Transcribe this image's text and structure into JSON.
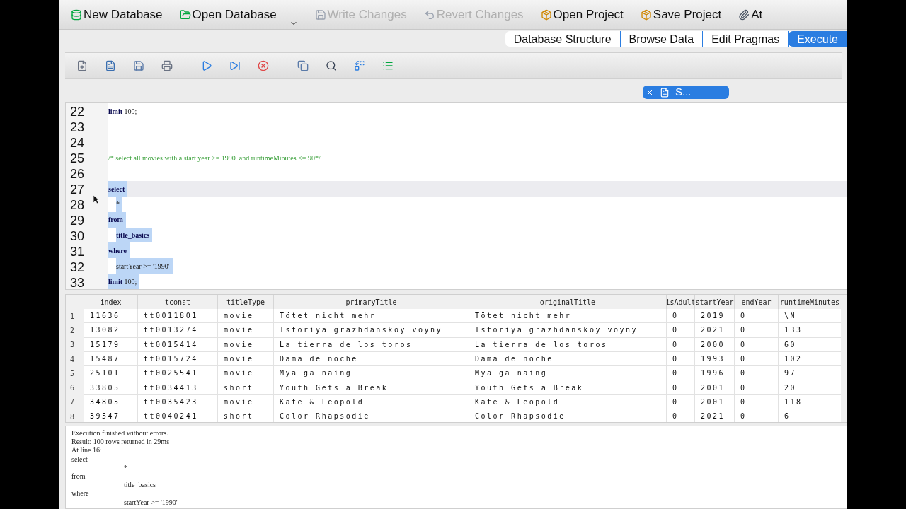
{
  "toolbar": [
    {
      "label": "New Database",
      "disabled": false,
      "dropdown": false
    },
    {
      "label": "Open Database",
      "disabled": false,
      "dropdown": true
    },
    {
      "label": "Write Changes",
      "disabled": true,
      "dropdown": false
    },
    {
      "label": "Revert Changes",
      "disabled": true,
      "dropdown": false
    },
    {
      "label": "Open Project",
      "disabled": false,
      "dropdown": false
    },
    {
      "label": "Save Project",
      "disabled": false,
      "dropdown": false
    },
    {
      "label": "At",
      "disabled": false,
      "dropdown": false
    }
  ],
  "tabs": [
    {
      "label": "Database Structure",
      "selected": false
    },
    {
      "label": "Browse Data",
      "selected": false
    },
    {
      "label": "Edit Pragmas",
      "selected": false
    },
    {
      "label": "Execute",
      "selected": true
    }
  ],
  "sql_tab": {
    "label": "S..."
  },
  "editor": {
    "lines": [
      {
        "number": "22",
        "indent": false,
        "selected": false,
        "current": false,
        "tokens": [
          {
            "text": "limit",
            "kind": "keyword"
          },
          {
            "text": " 100;",
            "kind": "plain"
          }
        ]
      },
      {
        "number": "23",
        "selected": false,
        "current": false
      },
      {
        "number": "24",
        "selected": false,
        "current": false
      },
      {
        "number": "25",
        "indent": false,
        "selected": false,
        "current": false,
        "tokens": [
          {
            "text": "/* select all movies with a start year >= 1990  and runtimeMinutes <= 90*/",
            "kind": "comment"
          }
        ]
      },
      {
        "number": "26",
        "selected": false,
        "current": false
      },
      {
        "number": "27",
        "indent": false,
        "selected": true,
        "current": true,
        "tokens": [
          {
            "text": "select",
            "kind": "keyword"
          }
        ]
      },
      {
        "number": "28",
        "indent": true,
        "selected": true,
        "current": false,
        "tokens": [
          {
            "text": "*",
            "kind": "plain"
          }
        ]
      },
      {
        "number": "29",
        "indent": false,
        "selected": true,
        "current": false,
        "tokens": [
          {
            "text": "from",
            "kind": "keyword"
          }
        ]
      },
      {
        "number": "30",
        "indent": true,
        "selected": true,
        "current": false,
        "tokens": [
          {
            "text": "title_basics",
            "kind": "keyword"
          }
        ]
      },
      {
        "number": "31",
        "indent": false,
        "selected": true,
        "current": false,
        "tokens": [
          {
            "text": "where",
            "kind": "keyword"
          }
        ]
      },
      {
        "number": "32",
        "indent": true,
        "selected": true,
        "current": false,
        "tokens": [
          {
            "text": "startYear >= '1990'",
            "kind": "plain"
          }
        ]
      },
      {
        "number": "33",
        "indent": false,
        "selected": true,
        "current": false,
        "tokens": [
          {
            "text": "limit",
            "kind": "keyword"
          },
          {
            "text": " 100;",
            "kind": "plain"
          }
        ]
      }
    ]
  },
  "results": {
    "columns": [
      "index",
      "tconst",
      "titleType",
      "primaryTitle",
      "originalTitle",
      "isAdult",
      "startYear",
      "endYear",
      "runtimeMinutes"
    ],
    "rows": [
      {
        "number": "1",
        "cells": [
          "11636",
          "tt0011801",
          "movie",
          "Tötet nicht mehr",
          "Tötet nicht mehr",
          "0",
          "2019",
          "0",
          "\\N"
        ]
      },
      {
        "number": "2",
        "cells": [
          "13082",
          "tt0013274",
          "movie",
          "Istoriya grazhdanskoy voyny",
          "Istoriya grazhdanskoy voyny",
          "0",
          "2021",
          "0",
          "133"
        ]
      },
      {
        "number": "3",
        "cells": [
          "15179",
          "tt0015414",
          "movie",
          "La tierra de los toros",
          "La tierra de los toros",
          "0",
          "2000",
          "0",
          "60"
        ]
      },
      {
        "number": "4",
        "cells": [
          "15487",
          "tt0015724",
          "movie",
          "Dama de noche",
          "Dama de noche",
          "0",
          "1993",
          "0",
          "102"
        ]
      },
      {
        "number": "5",
        "cells": [
          "25101",
          "tt0025541",
          "movie",
          "Mya ga naing",
          "Mya ga naing",
          "0",
          "1996",
          "0",
          "97"
        ]
      },
      {
        "number": "6",
        "cells": [
          "33805",
          "tt0034413",
          "short",
          "Youth Gets a Break",
          "Youth Gets a Break",
          "0",
          "2001",
          "0",
          "20"
        ]
      },
      {
        "number": "7",
        "cells": [
          "34805",
          "tt0035423",
          "movie",
          "Kate & Leopold",
          "Kate & Leopold",
          "0",
          "2001",
          "0",
          "118"
        ]
      },
      {
        "number": "8",
        "cells": [
          "39547",
          "tt0040241",
          "short",
          "Color Rhapsodie",
          "Color Rhapsodie",
          "0",
          "2021",
          "0",
          "6"
        ]
      }
    ]
  },
  "message_log": [
    {
      "text": "Execution finished without errors.",
      "indent": false
    },
    {
      "text": "Result: 100 rows returned in 29ms",
      "indent": false
    },
    {
      "text": "At line 16:",
      "indent": false
    },
    {
      "text": "select",
      "indent": false
    },
    {
      "text": "*",
      "indent": true
    },
    {
      "text": "from",
      "indent": false
    },
    {
      "text": "title_basics",
      "indent": true
    },
    {
      "text": "where",
      "indent": false
    },
    {
      "text": "startYear >= '1990'",
      "indent": true
    }
  ]
}
